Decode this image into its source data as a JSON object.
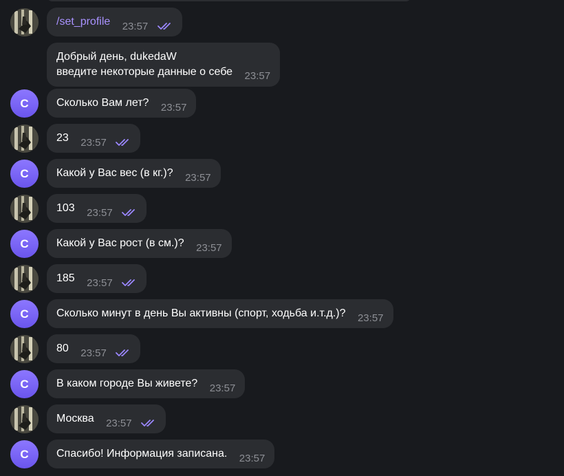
{
  "colors": {
    "background": "#181a1e",
    "bubble": "#2b2d31",
    "text": "#ffffff",
    "command": "#a992ff",
    "time": "#8d8f95",
    "checks": "#9b87ff",
    "bot_avatar": "#7b66f5"
  },
  "icons": {
    "read_receipt": "double-check-icon",
    "user_avatar": "user-photo-avatar",
    "bot_avatar": "letter-avatar"
  },
  "messages": [
    {
      "sender": "user",
      "text": "/set_profile",
      "time": "23:57",
      "read": true
    },
    {
      "sender": "bot",
      "text": "Добрый день, dukedaW",
      "text2": "введите некоторые данные о себе",
      "time": "23:57"
    },
    {
      "sender": "bot",
      "avatar_letter": "C",
      "text": "Сколько Вам лет?",
      "time": "23:57"
    },
    {
      "sender": "user",
      "text": "23",
      "time": "23:57",
      "read": true
    },
    {
      "sender": "bot",
      "avatar_letter": "C",
      "text": "Какой у Вас вес (в кг.)?",
      "time": "23:57"
    },
    {
      "sender": "user",
      "text": "103",
      "time": "23:57",
      "read": true
    },
    {
      "sender": "bot",
      "avatar_letter": "C",
      "text": "Какой у Вас рост (в см.)?",
      "time": "23:57"
    },
    {
      "sender": "user",
      "text": "185",
      "time": "23:57",
      "read": true
    },
    {
      "sender": "bot",
      "avatar_letter": "C",
      "text": "Сколько минут в день Вы активны (спорт, ходьба и.т.д.)?",
      "time": "23:57"
    },
    {
      "sender": "user",
      "text": "80",
      "time": "23:57",
      "read": true
    },
    {
      "sender": "bot",
      "avatar_letter": "C",
      "text": "В каком городе Вы живете?",
      "time": "23:57"
    },
    {
      "sender": "user",
      "text": "Москва",
      "time": "23:57",
      "read": true
    },
    {
      "sender": "bot",
      "avatar_letter": "C",
      "text": "Спасибо! Информация записана.",
      "time": "23:57"
    }
  ]
}
